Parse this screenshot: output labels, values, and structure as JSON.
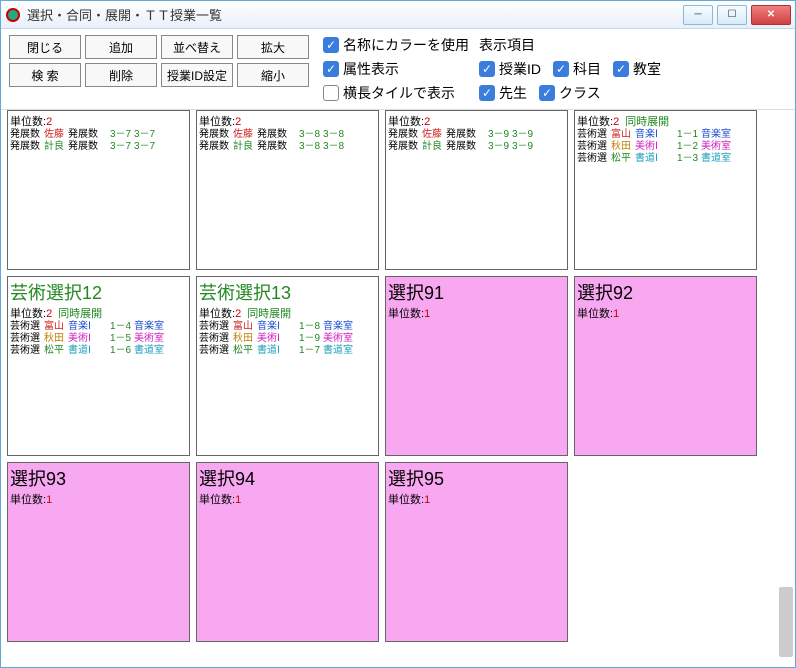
{
  "window": {
    "title": "選択・合同・展開・ＴＴ授業一覧"
  },
  "toolbar": {
    "close": "閉じる",
    "add": "追加",
    "sort": "並べ替え",
    "zoomin": "拡大",
    "search": "検 索",
    "delete": "削除",
    "idset": "授業ID設定",
    "zoomout": "縮小"
  },
  "checks": {
    "nameColor": "名称にカラーを使用",
    "attrShow": "属性表示",
    "wideTile": "横長タイルで表示",
    "dispHeader": "表示項目",
    "lessonId": "授業ID",
    "subject": "科目",
    "room": "教室",
    "teacher": "先生",
    "cls": "クラス"
  },
  "tiles": [
    {
      "partial": true,
      "pink": false,
      "subUnits": "2",
      "rows": [
        {
          "a": "発展数",
          "b": "佐藤",
          "bcls": "c-red",
          "c": "発展数",
          "d": "3－7",
          "dcls": "c-green",
          "e": "3－7",
          "ecls": "c-green"
        },
        {
          "a": "発展数",
          "b": "計良",
          "bcls": "c-green",
          "c": "発展数",
          "d": "3－7",
          "dcls": "c-green",
          "e": "3－7",
          "ecls": "c-green"
        }
      ]
    },
    {
      "partial": true,
      "pink": false,
      "subUnits": "2",
      "rows": [
        {
          "a": "発展数",
          "b": "佐藤",
          "bcls": "c-red",
          "c": "発展数",
          "d": "3－8",
          "dcls": "c-green",
          "e": "3－8",
          "ecls": "c-green"
        },
        {
          "a": "発展数",
          "b": "計良",
          "bcls": "c-green",
          "c": "発展数",
          "d": "3－8",
          "dcls": "c-green",
          "e": "3－8",
          "ecls": "c-green"
        }
      ]
    },
    {
      "partial": true,
      "pink": false,
      "subUnits": "2",
      "rows": [
        {
          "a": "発展数",
          "b": "佐藤",
          "bcls": "c-red",
          "c": "発展数",
          "d": "3－9",
          "dcls": "c-green",
          "e": "3－9",
          "ecls": "c-green"
        },
        {
          "a": "発展数",
          "b": "計良",
          "bcls": "c-green",
          "c": "発展数",
          "d": "3－9",
          "dcls": "c-green",
          "e": "3－9",
          "ecls": "c-green"
        }
      ]
    },
    {
      "partial": true,
      "pink": false,
      "subUnits": "2",
      "subLabel": "同時展開",
      "rows": [
        {
          "a": "芸術選",
          "b": "富山",
          "bcls": "c-red",
          "c": "音楽Ⅰ",
          "ccls": "c-blue",
          "d": "1－1",
          "dcls": "c-green",
          "e": "音楽室",
          "ecls": "c-blue"
        },
        {
          "a": "芸術選",
          "b": "秋田",
          "bcls": "c-orange",
          "c": "美術Ⅰ",
          "ccls": "c-magenta",
          "d": "1－2",
          "dcls": "c-green",
          "e": "美術室",
          "ecls": "c-magenta"
        },
        {
          "a": "芸術選",
          "b": "松平",
          "bcls": "c-green",
          "c": "書道Ⅰ",
          "ccls": "c-cyan",
          "d": "1－3",
          "dcls": "c-green",
          "e": "書道室",
          "ecls": "c-cyan"
        }
      ]
    },
    {
      "title": "芸術選択12",
      "titleCls": "",
      "subUnits": "2",
      "subLabel": "同時展開",
      "rows": [
        {
          "a": "芸術選",
          "b": "富山",
          "bcls": "c-red",
          "c": "音楽Ⅰ",
          "ccls": "c-blue",
          "d": "1－4",
          "dcls": "c-green",
          "e": "音楽室",
          "ecls": "c-blue"
        },
        {
          "a": "芸術選",
          "b": "秋田",
          "bcls": "c-orange",
          "c": "美術Ⅰ",
          "ccls": "c-magenta",
          "d": "1－5",
          "dcls": "c-green",
          "e": "美術室",
          "ecls": "c-magenta"
        },
        {
          "a": "芸術選",
          "b": "松平",
          "bcls": "c-green",
          "c": "書道Ⅰ",
          "ccls": "c-cyan",
          "d": "1－6",
          "dcls": "c-green",
          "e": "書道室",
          "ecls": "c-cyan"
        }
      ]
    },
    {
      "title": "芸術選択13",
      "titleCls": "",
      "subUnits": "2",
      "subLabel": "同時展開",
      "rows": [
        {
          "a": "芸術選",
          "b": "富山",
          "bcls": "c-red",
          "c": "音楽Ⅰ",
          "ccls": "c-blue",
          "d": "1－8",
          "dcls": "c-green",
          "e": "音楽室",
          "ecls": "c-blue"
        },
        {
          "a": "芸術選",
          "b": "秋田",
          "bcls": "c-orange",
          "c": "美術Ⅰ",
          "ccls": "c-magenta",
          "d": "1－9",
          "dcls": "c-green",
          "e": "美術室",
          "ecls": "c-magenta"
        },
        {
          "a": "芸術選",
          "b": "松平",
          "bcls": "c-green",
          "c": "書道Ⅰ",
          "ccls": "c-cyan",
          "d": "1－7",
          "dcls": "c-green",
          "e": "書道室",
          "ecls": "c-cyan"
        }
      ]
    },
    {
      "title": "選択91",
      "titleCls": "black",
      "pink": true,
      "subUnits": "1",
      "rows": []
    },
    {
      "title": "選択92",
      "titleCls": "black",
      "pink": true,
      "subUnits": "1",
      "rows": []
    },
    {
      "title": "選択93",
      "titleCls": "black",
      "pink": true,
      "subUnits": "1",
      "rows": []
    },
    {
      "title": "選択94",
      "titleCls": "black",
      "pink": true,
      "subUnits": "1",
      "rows": []
    },
    {
      "title": "選択95",
      "titleCls": "black",
      "pink": true,
      "subUnits": "1",
      "rows": []
    }
  ],
  "unitLabel": "単位数:"
}
